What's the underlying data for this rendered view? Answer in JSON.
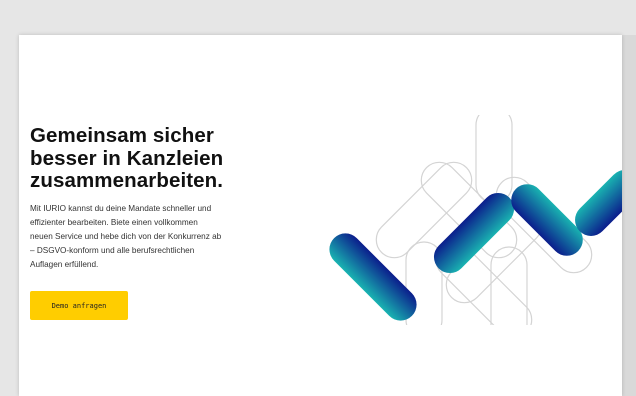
{
  "hero": {
    "headline_lines": [
      "Gemeinsam sicher",
      "besser in Kanzleien",
      "zusammenarbeiten."
    ],
    "body_lines": [
      "Mit IURIO kannst du deine Mandate schneller und",
      "effizienter bearbeiten. Biete einen vollkommen",
      "neuen Service und hebe dich von der Konkurrenz ab",
      "– DSGVO-konform und alle berufsrechtlichen",
      "Auflagen erfüllend."
    ],
    "cta_label": "Demo anfragen"
  },
  "colors": {
    "accent_yellow": "#ffcd00",
    "teal": "#19b3b1",
    "navy": "#0b1d8c"
  },
  "icons": {
    "hero_graphic": "iurio-logo-pattern"
  }
}
